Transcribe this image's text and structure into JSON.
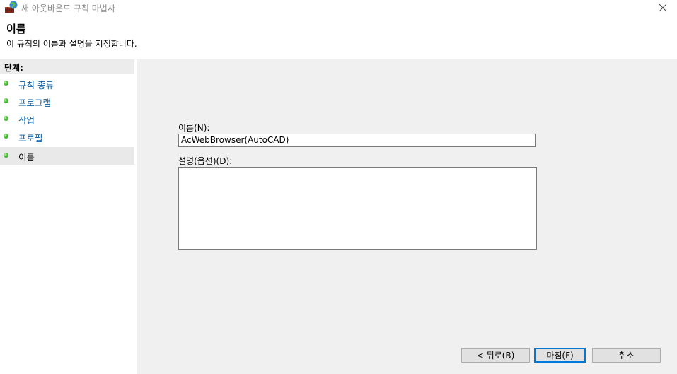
{
  "window": {
    "title": "새 아웃바운드 규칙 마법사"
  },
  "header": {
    "title": "이름",
    "subtitle": "이 규칙의 이름과 설명을 지정합니다."
  },
  "steps": {
    "heading": "단계:",
    "items": [
      {
        "label": "규칙 종류"
      },
      {
        "label": "프로그램"
      },
      {
        "label": "작업"
      },
      {
        "label": "프로필"
      },
      {
        "label": "이름"
      }
    ]
  },
  "form": {
    "name_label": "이름(N):",
    "name_value": "AcWebBrowser(AutoCAD)",
    "desc_label": "설명(옵션)(D):",
    "desc_value": ""
  },
  "buttons": {
    "back": "< 뒤로(B)",
    "finish": "마침(F)",
    "cancel": "취소"
  },
  "colors": {
    "step_link": "#0b5fa5",
    "default_button_border": "#0078d7",
    "panel_bg": "#f0f0f0"
  }
}
